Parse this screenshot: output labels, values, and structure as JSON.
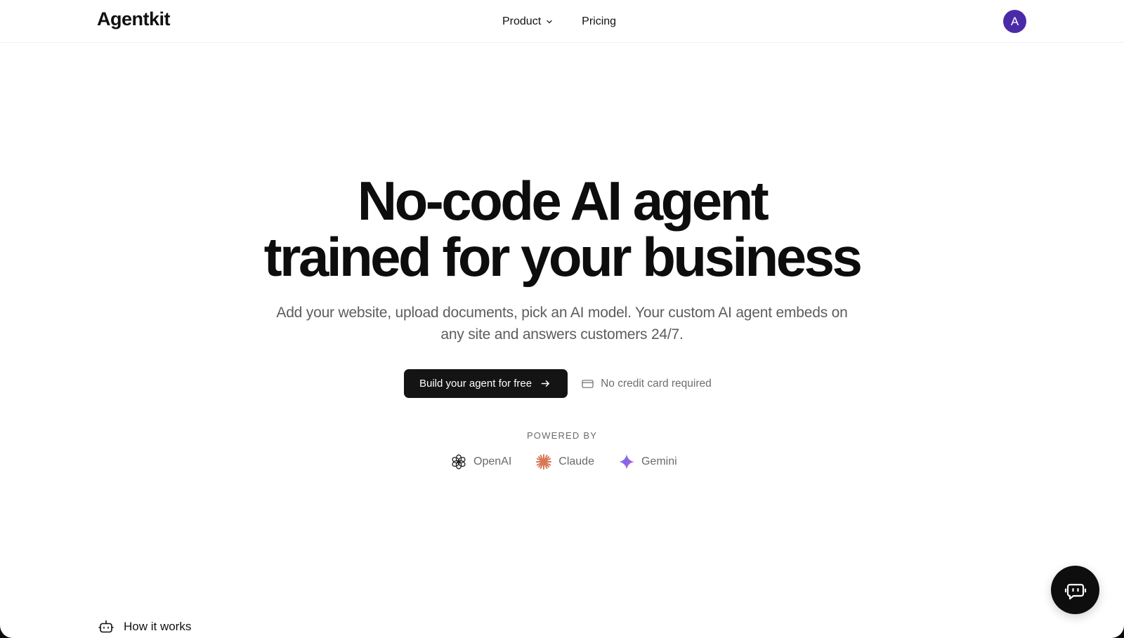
{
  "header": {
    "brand": "Agentkit",
    "nav": [
      {
        "label": "Product",
        "has_dropdown": true
      },
      {
        "label": "Pricing",
        "has_dropdown": false
      }
    ],
    "avatar_initial": "A",
    "avatar_color": "#4b2aa8"
  },
  "hero": {
    "title_line1": "No-code AI agent",
    "title_line2": "trained for your business",
    "subtitle": "Add your website, upload documents, pick an AI model. Your custom AI agent embeds on any site and answers customers 24/7.",
    "cta_label": "Build your agent for free",
    "cta_icon": "arrow-right-icon",
    "note": "No credit card required",
    "note_icon": "credit-card-icon"
  },
  "powered_by": {
    "label": "POWERED BY",
    "providers": [
      {
        "name": "OpenAI",
        "icon": "openai-icon"
      },
      {
        "name": "Claude",
        "icon": "claude-icon",
        "color": "#d97757"
      },
      {
        "name": "Gemini",
        "icon": "gemini-icon",
        "color": "#6b6ee8"
      }
    ]
  },
  "bottom": {
    "section_link": "How it works",
    "section_icon": "robot-icon",
    "chat_icon": "chat-bot-icon"
  }
}
